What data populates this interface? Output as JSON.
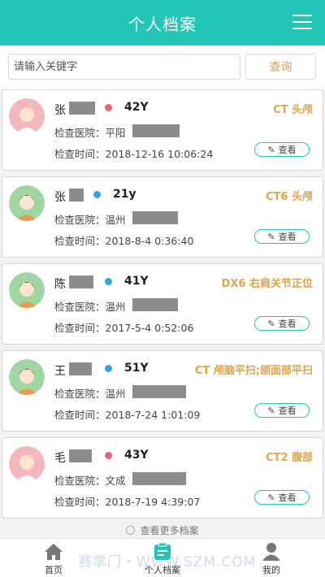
{
  "header": {
    "title": "个人档案"
  },
  "search": {
    "placeholder": "请输入关键字",
    "button_label": "查询"
  },
  "records": [
    {
      "name": "张",
      "gender": "female",
      "age": "42Y",
      "exam": "CT 头颅",
      "hospital_label": "检查医院：",
      "hospital": "平阳",
      "time_label": "检查时间：",
      "time": "2018-12-16 10:06:24",
      "view_label": "查看"
    },
    {
      "name": "张",
      "gender": "male",
      "age": "21y",
      "exam": "CT6 头颅",
      "hospital_label": "检查医院：",
      "hospital": "温州",
      "time_label": "检查时间：",
      "time": "2018-8-4 0:36:40",
      "view_label": "查看"
    },
    {
      "name": "陈",
      "gender": "male",
      "age": "41Y",
      "exam": "DX6 右肩关节正位",
      "hospital_label": "检查医院：",
      "hospital": "温州",
      "time_label": "检查时间：",
      "time": "2017-5-4 0:52:06",
      "view_label": "查看"
    },
    {
      "name": "王",
      "gender": "male",
      "age": "51Y",
      "exam": "CT 颅脑平扫;颌面部平扫",
      "hospital_label": "检查医院：",
      "hospital": "温州",
      "time_label": "检查时间：",
      "time": "2018-7-24 1:01:09",
      "view_label": "查看"
    },
    {
      "name": "毛",
      "gender": "female",
      "age": "43Y",
      "exam": "CT2 腹部",
      "hospital_label": "检查医院：",
      "hospital": "文成",
      "time_label": "检查时间：",
      "time": "2018-7-19 4:39:07",
      "view_label": "查看"
    }
  ],
  "more_label": "查看更多档案",
  "tabs": [
    {
      "label": "首页",
      "icon": "home-icon"
    },
    {
      "label": "个人档案",
      "icon": "record-icon"
    },
    {
      "label": "我的",
      "icon": "user-icon"
    }
  ],
  "watermark": "赛掌门・WWW.SZM.COM",
  "colors": {
    "accent": "#23c5b9",
    "exam_text": "#e1a34d",
    "female": "#e8637f",
    "male": "#2fa8d8"
  }
}
